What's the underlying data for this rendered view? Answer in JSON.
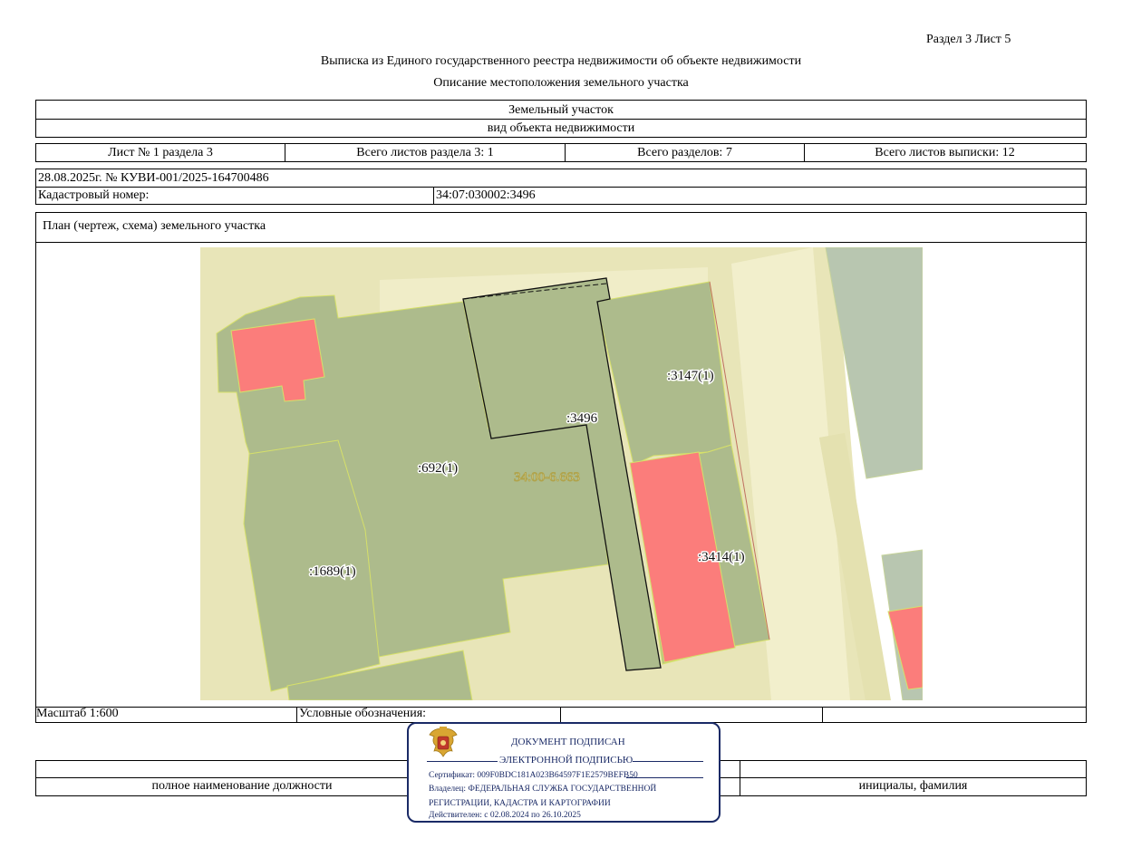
{
  "header": {
    "section_sheet": "Раздел 3    Лист 5",
    "title": "Выписка из Единого государственного реестра недвижимости об объекте недвижимости",
    "subtitle": "Описание местоположения земельного участка"
  },
  "object": {
    "type": "Земельный участок",
    "type_caption": "вид объекта недвижимости"
  },
  "sheets_row": {
    "sheet": "Лист № 1 раздела 3",
    "total_sheets_section": "Всего листов раздела 3: 1",
    "total_sections": "Всего разделов: 7",
    "total_sheets": "Всего листов выписки: 12"
  },
  "record": {
    "date_number": "28.08.2025г. № КУВИ-001/2025-164700486",
    "cadastral_label": "Кадастровый номер:",
    "cadastral_value": "34:07:030002:3496"
  },
  "plan": {
    "title": "План (чертеж, схема) земельного участка",
    "labels": {
      "p3496": ":3496",
      "p3147": ":3147(1)",
      "p692": ":692(1)",
      "zone": "34:00-6.663",
      "p1689": ":1689(1)",
      "p3414": ":3414(1)"
    },
    "colors": {
      "background": "#e8e5b8",
      "parcel": "#adbb8c",
      "building": "#fb7d7b",
      "grey": "#b8c6b0"
    }
  },
  "footer": {
    "scale": "Масштаб 1:600",
    "legend": "Условные обозначения:",
    "position_caption": "полное наименование должности",
    "name_caption": "инициалы, фамилия"
  },
  "stamp": {
    "line1": "ДОКУМЕНТ ПОДПИСАН",
    "line2": "ЭЛЕКТРОННОЙ ПОДПИСЬЮ",
    "certificate": "Сертификат: 009F0BDC181A023B64597F1E2579BEFB50",
    "owner1": "Владелец: ФЕДЕРАЛЬНАЯ СЛУЖБА ГОСУДАРСТВЕННОЙ",
    "owner2": "РЕГИСТРАЦИИ, КАДАСТРА И КАРТОГРАФИИ",
    "valid": "Действителен: с 02.08.2024 по 26.10.2025"
  }
}
